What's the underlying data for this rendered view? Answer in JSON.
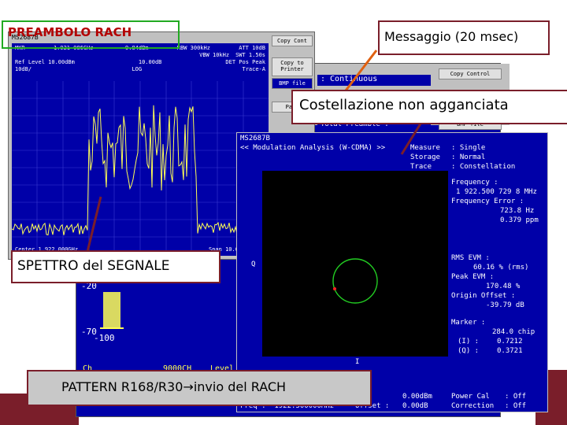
{
  "callouts": {
    "preambolo": "PREAMBOLO RACH",
    "messaggio": "Messaggio  (20 msec)",
    "costellazione": "Costellazione non agganciata",
    "spettro": "SPETTRO del SEGNALE",
    "pattern": "PATTERN R168/R30",
    "pattern_arrow": "→",
    "pattern_tail": "invio del RACH"
  },
  "spectrum": {
    "model": "MS2687B",
    "mkr": "MKR",
    "mkr_freq": "1.921 986GHz",
    "mkr_level": "-9.84dBm",
    "ref": "Ref Level  10.00dBm",
    "ref2": "10.00dB",
    "scale": "10dB/",
    "log": "LOG",
    "rbw": "RBW 300kHz",
    "vbw": "VBW 10kHz",
    "att": "ATT 10dB",
    "swt": "SWT 1.50s",
    "det": "DET Pos Peak",
    "trace": "Trace-A",
    "center": "Center 1.922 000GHz",
    "span": "Span 10.00",
    "buttons": [
      "Copy Cont",
      "Copy to Printer",
      "BMP file",
      "Page"
    ]
  },
  "backscreen": {
    "level_minus20": "-20",
    "level_minus70": "-70",
    "level_minus100": "-100",
    "ch_label": "Ch",
    "ch_value": "9000CH",
    "level_label": "Level",
    "continuous": ": Continuous",
    "total_preamble": "Total Preamble :",
    "copy_control": "Copy Control",
    "bmp_file": "BMP file"
  },
  "modulation": {
    "model": "MS2687B",
    "title": "<< Modulation Analysis (W-CDMA) >>",
    "measure_label": "Measure",
    "measure_value": ": Single",
    "storage_label": "Storage",
    "storage_value": ": Normal",
    "trace_label": "Trace",
    "trace_value": ": Constellation",
    "frequency_label": "Frequency :",
    "frequency_value": "1 922.500 729 8 MHz",
    "freq_error_label": "Frequency Error :",
    "freq_error_hz": "723.8 Hz",
    "freq_error_ppm": "0.379 ppm",
    "rms_evm_label": "RMS EVM :",
    "rms_evm_value": "60.16 % (rms)",
    "peak_evm_label": "Peak EVM :",
    "peak_evm_value": "170.48 %",
    "origin_offset_label": "Origin Offset :",
    "origin_offset_value": "-39.79 dB",
    "marker_label": "Marker :",
    "marker_value": "284.0 chip",
    "i_label": "(I) :",
    "i_value": "0.7212",
    "q_label": "(Q) :",
    "q_value": "0.3721",
    "q_axis": "Q",
    "i_axis": "I",
    "power_cal_label": "Power Cal",
    "power_cal_value": ": Off",
    "correction_label": "Correction",
    "correction_value": ": Off",
    "freq_bottom": "Freq :  1922.500000MHz",
    "offset_label": "Offset :",
    "offset_value": "0.00dB",
    "l_label": "l :",
    "l_value": "0.00dBm"
  },
  "colors": {
    "screen_blue": "#0000a8",
    "trace_yellow": "#ffff55",
    "constellation_green": "#22cc22",
    "marker_red": "#ff2222",
    "callout_border": "#7a1e2a",
    "preamble_red": "#b30000"
  }
}
